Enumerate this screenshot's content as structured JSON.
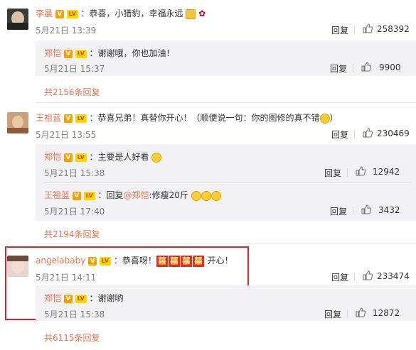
{
  "comments": [
    {
      "name": "李晨",
      "text": "：恭喜，小猎豹，幸福永远",
      "time": "5月21日 13:39",
      "reply_label": "回复",
      "likes": "258392",
      "sub": [
        {
          "name": "郑恺",
          "text": "：谢谢哦，你也加油！",
          "time": "5月21日 15:37",
          "reply_label": "回复",
          "likes": "9900"
        }
      ],
      "more": "共2156条回复"
    },
    {
      "name": "王祖蓝",
      "text": "：恭喜兄弟！真替你开心！（顺便说一句：你的图修的真不错",
      "text_end": "）",
      "time": "5月21日 13:55",
      "reply_label": "回复",
      "likes": "230469",
      "sub": [
        {
          "name": "郑恺",
          "text": "：主要是人好看",
          "time": "5月21日 15:38",
          "reply_label": "回复",
          "likes": "12942"
        },
        {
          "name": "王祖蓝",
          "text_prefix": "：回复",
          "mention": "@郑恺",
          "text": ":修瘦20斤",
          "time": "5月21日 17:40",
          "reply_label": "回复",
          "likes": "3432"
        }
      ],
      "more": "共2194条回复"
    },
    {
      "name": "angelababy",
      "text": "：恭喜呀！",
      "xi": [
        "囍",
        "囍",
        "囍",
        "囍"
      ],
      "text_end": " 开心！",
      "time": "5月21日 14:11",
      "reply_label": "回复",
      "likes": "233474",
      "sub": [
        {
          "name": "郑恺",
          "text": "：谢谢哟",
          "time": "5月21日 15:38",
          "reply_label": "回复",
          "likes": "12872"
        }
      ],
      "more": "共6115条回复"
    }
  ],
  "badges": {
    "verified": "V",
    "level": "LV"
  },
  "colors": {
    "name": "#eb7350",
    "highlight": "#d8252a",
    "sub_bg": "#f2f2f5"
  },
  "icons": [
    "thumb-up-icon",
    "verified-badge-icon",
    "level-badge-icon",
    "emoji-icon",
    "rose-icon",
    "avatar"
  ]
}
